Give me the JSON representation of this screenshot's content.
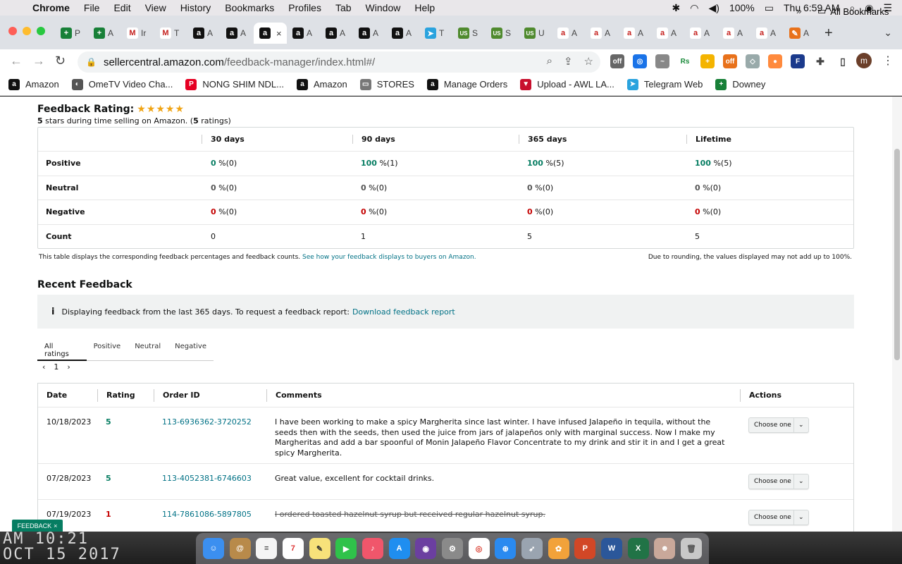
{
  "menubar": {
    "app": "Chrome",
    "items": [
      "File",
      "Edit",
      "View",
      "History",
      "Bookmarks",
      "Profiles",
      "Tab",
      "Window",
      "Help"
    ],
    "battery": "100%",
    "clock": "Thu 6:59 AM"
  },
  "tabs": [
    {
      "letter": "P",
      "icon": "sheets-icon",
      "color": "#188038",
      "glyph": "+"
    },
    {
      "letter": "A",
      "icon": "sheets-icon",
      "color": "#188038",
      "glyph": "+"
    },
    {
      "letter": "Ir",
      "icon": "gmail-icon",
      "color": "#ffffff",
      "glyph": "M"
    },
    {
      "letter": "T",
      "icon": "gmail-icon",
      "color": "#ffffff",
      "glyph": "M"
    },
    {
      "letter": "A",
      "icon": "amazon-icon",
      "color": "#111111",
      "glyph": "a"
    },
    {
      "letter": "A",
      "icon": "amazon-icon",
      "color": "#111111",
      "glyph": "a"
    },
    {
      "letter": "",
      "icon": "amazon-icon",
      "color": "#111111",
      "glyph": "a",
      "active": true
    },
    {
      "letter": "A",
      "icon": "amazon-icon",
      "color": "#111111",
      "glyph": "a"
    },
    {
      "letter": "A",
      "icon": "amazon-icon",
      "color": "#111111",
      "glyph": "a"
    },
    {
      "letter": "A",
      "icon": "amazon-icon",
      "color": "#111111",
      "glyph": "a"
    },
    {
      "letter": "A",
      "icon": "amazon-icon",
      "color": "#111111",
      "glyph": "a"
    },
    {
      "letter": "T",
      "icon": "telegram-icon",
      "color": "#2aa3de",
      "glyph": "➤"
    },
    {
      "letter": "S",
      "icon": "usfoods-icon",
      "color": "#4f8a2e",
      "glyph": "US"
    },
    {
      "letter": "S",
      "icon": "usfoods-icon",
      "color": "#4f8a2e",
      "glyph": "US"
    },
    {
      "letter": "U",
      "icon": "usfoods-icon",
      "color": "#4f8a2e",
      "glyph": "US"
    },
    {
      "letter": "A",
      "icon": "amazon-smile-icon",
      "color": "#ffffff",
      "glyph": "a"
    },
    {
      "letter": "A",
      "icon": "amazon-smile-icon",
      "color": "#ffffff",
      "glyph": "a"
    },
    {
      "letter": "A",
      "icon": "amazon-smile-icon",
      "color": "#ffffff",
      "glyph": "a"
    },
    {
      "letter": "A",
      "icon": "amazon-smile-icon",
      "color": "#ffffff",
      "glyph": "a"
    },
    {
      "letter": "A",
      "icon": "amazon-smile-icon",
      "color": "#ffffff",
      "glyph": "a"
    },
    {
      "letter": "A",
      "icon": "amazon-smile-icon",
      "color": "#ffffff",
      "glyph": "a"
    },
    {
      "letter": "A",
      "icon": "amazon-smile-icon",
      "color": "#ffffff",
      "glyph": "a"
    },
    {
      "letter": "A",
      "icon": "pencil-icon",
      "color": "#e8711a",
      "glyph": "✎"
    }
  ],
  "omnibox": {
    "domain": "sellercentral.amazon.com",
    "path": "/feedback-manager/index.html#/"
  },
  "bookmarks": [
    {
      "label": "Amazon",
      "icon": "amazon-icon",
      "color": "#111111",
      "glyph": "a"
    },
    {
      "label": "OmeTV Video Cha...",
      "icon": "globe-icon",
      "color": "#555555",
      "glyph": "◐"
    },
    {
      "label": "NONG SHIM NDL...",
      "icon": "pinterest-icon",
      "color": "#e60023",
      "glyph": "P"
    },
    {
      "label": "Amazon",
      "icon": "amazon-icon",
      "color": "#111111",
      "glyph": "a"
    },
    {
      "label": "STORES",
      "icon": "folder-icon",
      "color": "#777777",
      "glyph": "▭"
    },
    {
      "label": "Manage Orders",
      "icon": "amazon-icon",
      "color": "#111111",
      "glyph": "a"
    },
    {
      "label": "Upload - AWL LA...",
      "icon": "awl-icon",
      "color": "#c8102e",
      "glyph": "▼"
    },
    {
      "label": "Telegram Web",
      "icon": "telegram-icon",
      "color": "#2aa3de",
      "glyph": "➤"
    },
    {
      "label": "Downey",
      "icon": "sheets-icon",
      "color": "#188038",
      "glyph": "+"
    }
  ],
  "bookmarks_all": "All Bookmarks",
  "feedback_rating": {
    "title": "Feedback Rating:",
    "stars": "★★★★★",
    "summary_bold1": "5",
    "summary_text1": " stars during time selling on Amazon. (",
    "summary_bold2": "5",
    "summary_text2": " ratings)"
  },
  "rating_table": {
    "headers": [
      "",
      "30 days",
      "90 days",
      "365 days",
      "Lifetime"
    ],
    "rows": [
      {
        "label": "Positive",
        "cells": [
          {
            "v": "0",
            "u": " %(0)",
            "c": "green"
          },
          {
            "v": "100",
            "u": " %(1)",
            "c": "green"
          },
          {
            "v": "100",
            "u": " %(5)",
            "c": "green"
          },
          {
            "v": "100",
            "u": " %(5)",
            "c": "green"
          }
        ]
      },
      {
        "label": "Neutral",
        "cells": [
          {
            "v": "0",
            "u": " %(0)",
            "c": "gray"
          },
          {
            "v": "0",
            "u": " %(0)",
            "c": "gray"
          },
          {
            "v": "0",
            "u": " %(0)",
            "c": "gray"
          },
          {
            "v": "0",
            "u": " %(0)",
            "c": "gray"
          }
        ]
      },
      {
        "label": "Negative",
        "cells": [
          {
            "v": "0",
            "u": " %(0)",
            "c": "red"
          },
          {
            "v": "0",
            "u": " %(0)",
            "c": "red"
          },
          {
            "v": "0",
            "u": " %(0)",
            "c": "red"
          },
          {
            "v": "0",
            "u": " %(0)",
            "c": "red"
          }
        ]
      },
      {
        "label": "Count",
        "cells": [
          {
            "v": "",
            "u": "0",
            "c": ""
          },
          {
            "v": "",
            "u": "1",
            "c": ""
          },
          {
            "v": "",
            "u": "5",
            "c": ""
          },
          {
            "v": "",
            "u": "5",
            "c": ""
          }
        ]
      }
    ],
    "note": "This table displays the corresponding feedback percentages and feedback counts.",
    "note_link": "See how your feedback displays to buyers on Amazon.",
    "rounding_note": "Due to rounding, the values displayed may not add up to 100%."
  },
  "recent": {
    "title": "Recent Feedback",
    "info_text": "Displaying feedback from the last 365 days. To request a feedback report:",
    "info_link": "Download feedback report",
    "tabs": [
      "All ratings",
      "Positive",
      "Neutral",
      "Negative"
    ],
    "page": "1",
    "headers": {
      "date": "Date",
      "rating": "Rating",
      "order": "Order ID",
      "comments": "Comments",
      "actions": "Actions"
    },
    "rows": [
      {
        "date": "10/18/2023",
        "rating": "5",
        "rating_color": "green",
        "order": "113-6936362-3720252",
        "comment": "I have been working to make a spicy Margherita since last winter. I have infused Jalapeño in tequila, without the seeds then with the seeds, then used the juice from jars of jalapeños only with marginal success. Now I make my Margheritas and add a bar spoonful of Monin Jalapeño Flavor Concentrate to my drink and stir it in and I get a great spicy Margherita.",
        "strike": false
      },
      {
        "date": "07/28/2023",
        "rating": "5",
        "rating_color": "green",
        "order": "113-4052381-6746603",
        "comment": "Great value, excellent for cocktail drinks.",
        "strike": false
      },
      {
        "date": "07/19/2023",
        "rating": "1",
        "rating_color": "red",
        "order": "114-7861086-5897805",
        "comment": "I ordered toasted hazelnut syrup but received regular hazelnut syrup.",
        "strike": true
      }
    ],
    "action_label": "Choose one"
  },
  "feedback_badge": "FEEDBACK",
  "wallpaper_text": {
    "line1": "AM 10:21",
    "line2": "OCT 15 2017"
  },
  "colors": {
    "accent_link": "#007185",
    "positive": "#067d62",
    "negative": "#c40000",
    "star": "#f0a414"
  }
}
